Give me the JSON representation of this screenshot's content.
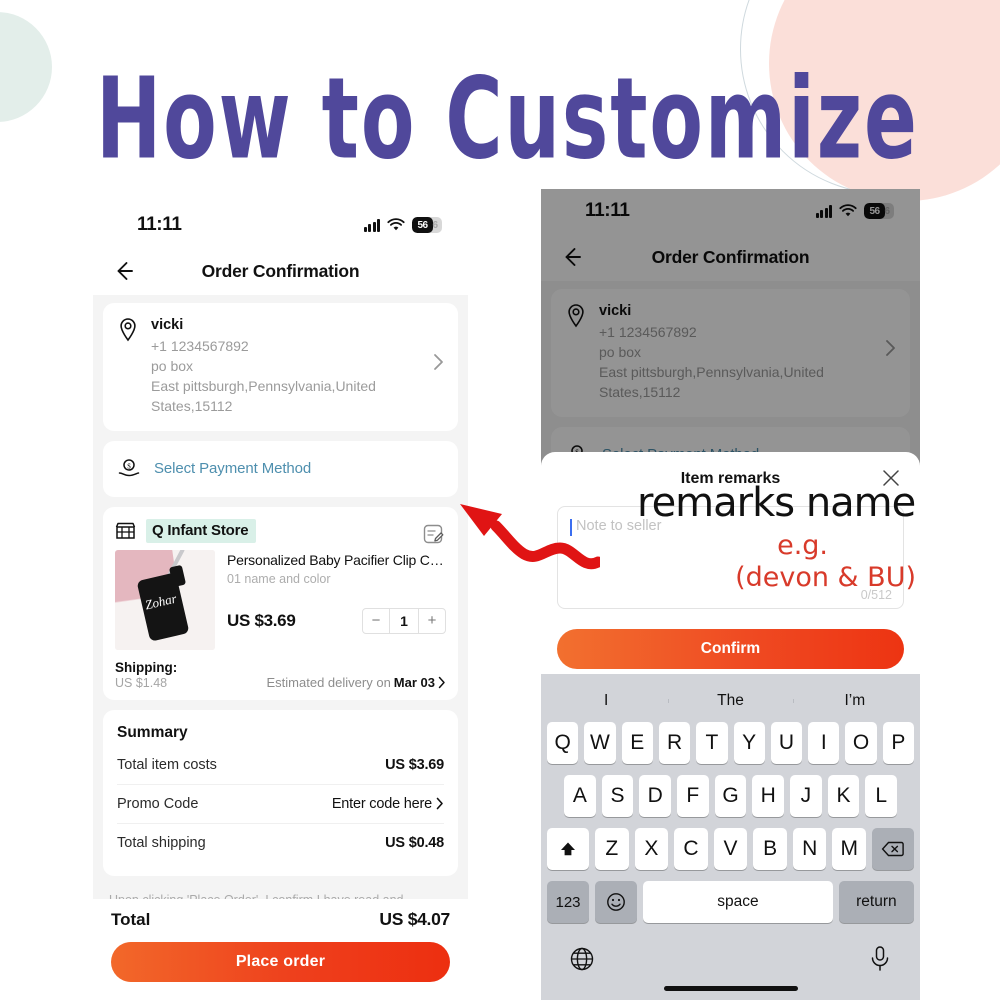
{
  "headline": "How to Customize",
  "colors": {
    "heading_purple": "#50489b",
    "accent_orange": "#ee4a1f",
    "annotation_red": "#d83a2a",
    "mint_highlight": "#d9f0e8",
    "pink_circle": "#fbdfd9",
    "mint_circle": "#e3eeea"
  },
  "status_bar": {
    "time": "11:11",
    "battery_level": "56"
  },
  "nav": {
    "title": "Order Confirmation",
    "back_icon": "arrow-left-icon"
  },
  "address": {
    "icon": "location-pin-icon",
    "name": "vicki",
    "phone": "+1 1234567892",
    "line1": "po box",
    "line2": "East pittsburgh,Pennsylvania,United",
    "line3": "States,15112",
    "chevron": "chevron-right-icon"
  },
  "payment": {
    "icon": "payment-hand-icon",
    "label": "Select Payment Method"
  },
  "store": {
    "icon": "storefront-icon",
    "name": "Q Infant Store",
    "edit_icon": "note-edit-icon"
  },
  "product": {
    "title": "Personalized Baby Pacifier Clip Custo…",
    "variant": "01 name and color",
    "price": "US $3.69",
    "quantity": "1",
    "minus": "−",
    "plus": "+",
    "thumb_text": "Zohar"
  },
  "shipping": {
    "label": "Shipping:",
    "cost": "US $1.48",
    "estimate_prefix": "Estimated delivery on",
    "estimate_date": "Mar 03"
  },
  "summary": {
    "title": "Summary",
    "rows": [
      {
        "label": "Total item costs",
        "value": "US $3.69",
        "is_link": false
      },
      {
        "label": "Promo Code",
        "value": "Enter code here",
        "is_link": true
      },
      {
        "label": "Total shipping",
        "value": "US $0.48",
        "is_link": false
      }
    ]
  },
  "disclaimer": "Upon clicking 'Place Order', I confirm I have read and",
  "bottom_bar": {
    "total_label": "Total",
    "total_value": "US $4.07",
    "cta_label": "Place order"
  },
  "sheet": {
    "title": "Item remarks",
    "close_icon": "close-icon",
    "note_placeholder": "Note to seller",
    "char_count": "0/512",
    "confirm_label": "Confirm"
  },
  "annotations": {
    "remarks_name": "remarks name",
    "eg": "e.g.",
    "example": "(devon & BU)",
    "arrow": "red-wavy-arrow"
  },
  "keyboard": {
    "suggestions": [
      "I",
      "The",
      "I’m"
    ],
    "row1": [
      "Q",
      "W",
      "E",
      "R",
      "T",
      "Y",
      "U",
      "I",
      "O",
      "P"
    ],
    "row2": [
      "A",
      "S",
      "D",
      "F",
      "G",
      "H",
      "J",
      "K",
      "L"
    ],
    "row3": [
      "Z",
      "X",
      "C",
      "V",
      "B",
      "N",
      "M"
    ],
    "shift_icon": "shift-up-icon",
    "backspace_icon": "backspace-icon",
    "numbers_key": "123",
    "emoji_icon": "emoji-smiley-icon",
    "space_label": "space",
    "return_label": "return",
    "globe_icon": "globe-icon",
    "mic_icon": "microphone-icon"
  }
}
